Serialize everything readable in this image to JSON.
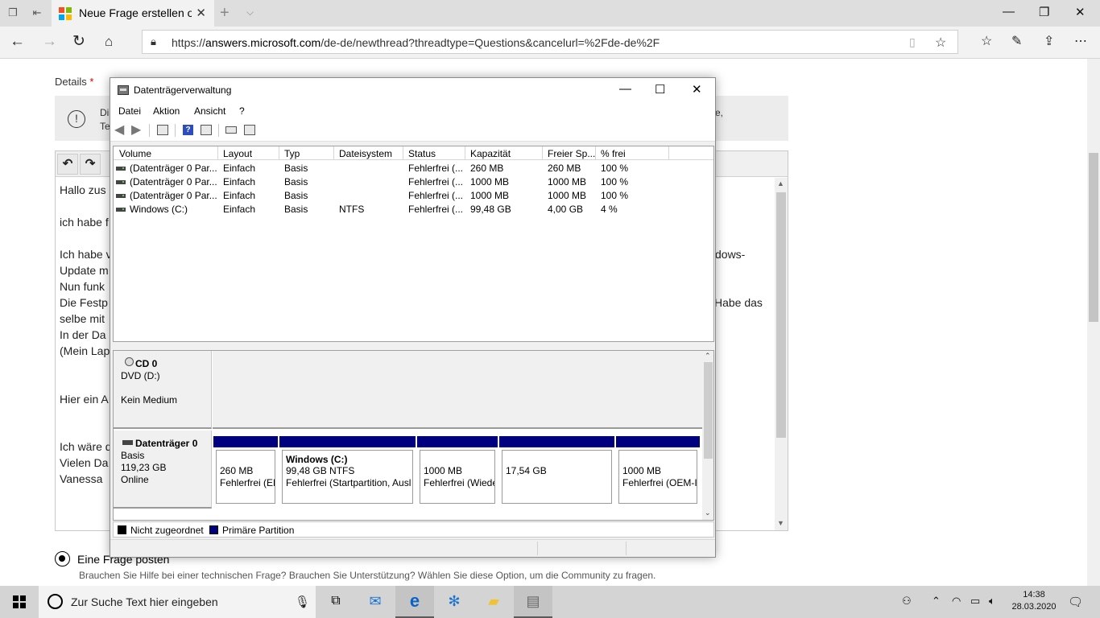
{
  "browser": {
    "tab_title": "Neue Frage erstellen oc",
    "url_scheme": "https://",
    "url_host": "answers.microsoft.com",
    "url_path": "/de-de/newthread?threadtype=Questions&cancelurl=%2Fde-de%2F"
  },
  "page": {
    "details_label": "Details",
    "required_mark": "*",
    "info_line1_start": "Di",
    "info_line2_start": "Te",
    "info_tail": "e,",
    "editor_lines": [
      "Hallo zus",
      "ich habe f",
      "Ich habe v",
      "Update m",
      "Nun funk",
      "Die Festp",
      "selbe mit",
      "In der Da",
      "(Mein Lap",
      "Hier ein A",
      "Ich wäre d",
      "Vielen Da",
      "Vanessa"
    ],
    "editor_right_fragments": [
      "dows-",
      "Habe das"
    ],
    "radio_label": "Eine Frage posten",
    "radio_sub": "Brauchen Sie Hilfe bei einer technischen Frage? Brauchen Sie Unterstützung? Wählen Sie diese Option, um die Community zu fragen."
  },
  "disk_mgmt": {
    "title": "Datenträgerverwaltung",
    "menu": [
      "Datei",
      "Aktion",
      "Ansicht",
      "?"
    ],
    "columns": [
      "Volume",
      "Layout",
      "Typ",
      "Dateisystem",
      "Status",
      "Kapazität",
      "Freier Sp...",
      "% frei"
    ],
    "volumes": [
      {
        "volume": "(Datenträger 0 Par...",
        "layout": "Einfach",
        "typ": "Basis",
        "fs": "",
        "status": "Fehlerfrei (...",
        "capacity": "260 MB",
        "free": "260 MB",
        "pct": "100 %"
      },
      {
        "volume": "(Datenträger 0 Par...",
        "layout": "Einfach",
        "typ": "Basis",
        "fs": "",
        "status": "Fehlerfrei (...",
        "capacity": "1000 MB",
        "free": "1000 MB",
        "pct": "100 %"
      },
      {
        "volume": "(Datenträger 0 Par...",
        "layout": "Einfach",
        "typ": "Basis",
        "fs": "",
        "status": "Fehlerfrei (...",
        "capacity": "1000 MB",
        "free": "1000 MB",
        "pct": "100 %"
      },
      {
        "volume": "Windows (C:)",
        "layout": "Einfach",
        "typ": "Basis",
        "fs": "NTFS",
        "status": "Fehlerfrei (...",
        "capacity": "99,48 GB",
        "free": "4,00 GB",
        "pct": "4 %"
      }
    ],
    "cd": {
      "name": "CD 0",
      "type": "DVD (D:)",
      "media": "Kein Medium"
    },
    "disk0": {
      "name": "Datenträger 0",
      "type": "Basis",
      "size": "119,23 GB",
      "state": "Online"
    },
    "partitions": [
      {
        "title": "",
        "line1": "260 MB",
        "line2": "Fehlerfrei (EF"
      },
      {
        "title": "Windows  (C:)",
        "line1": "99,48 GB NTFS",
        "line2": "Fehlerfrei (Startpartition, Ausl"
      },
      {
        "title": "",
        "line1": "1000 MB",
        "line2": "Fehlerfrei (Wiede"
      },
      {
        "title": "",
        "line1": "17,54 GB",
        "line2": ""
      },
      {
        "title": "",
        "line1": "1000 MB",
        "line2": "Fehlerfrei (OEM-I"
      }
    ],
    "legend": [
      {
        "label": "Nicht zugeordnet",
        "color": "#000000"
      },
      {
        "label": "Primäre Partition",
        "color": "#00007f"
      }
    ]
  },
  "taskbar": {
    "search_placeholder": "Zur Suche Text hier eingeben",
    "time": "14:38",
    "date": "28.03.2020"
  },
  "colors": {
    "partition_bar": "#00007f",
    "edge_blue": "#0a62c9",
    "mail_blue": "#1b75d0",
    "folder_yellow": "#f1c232"
  }
}
